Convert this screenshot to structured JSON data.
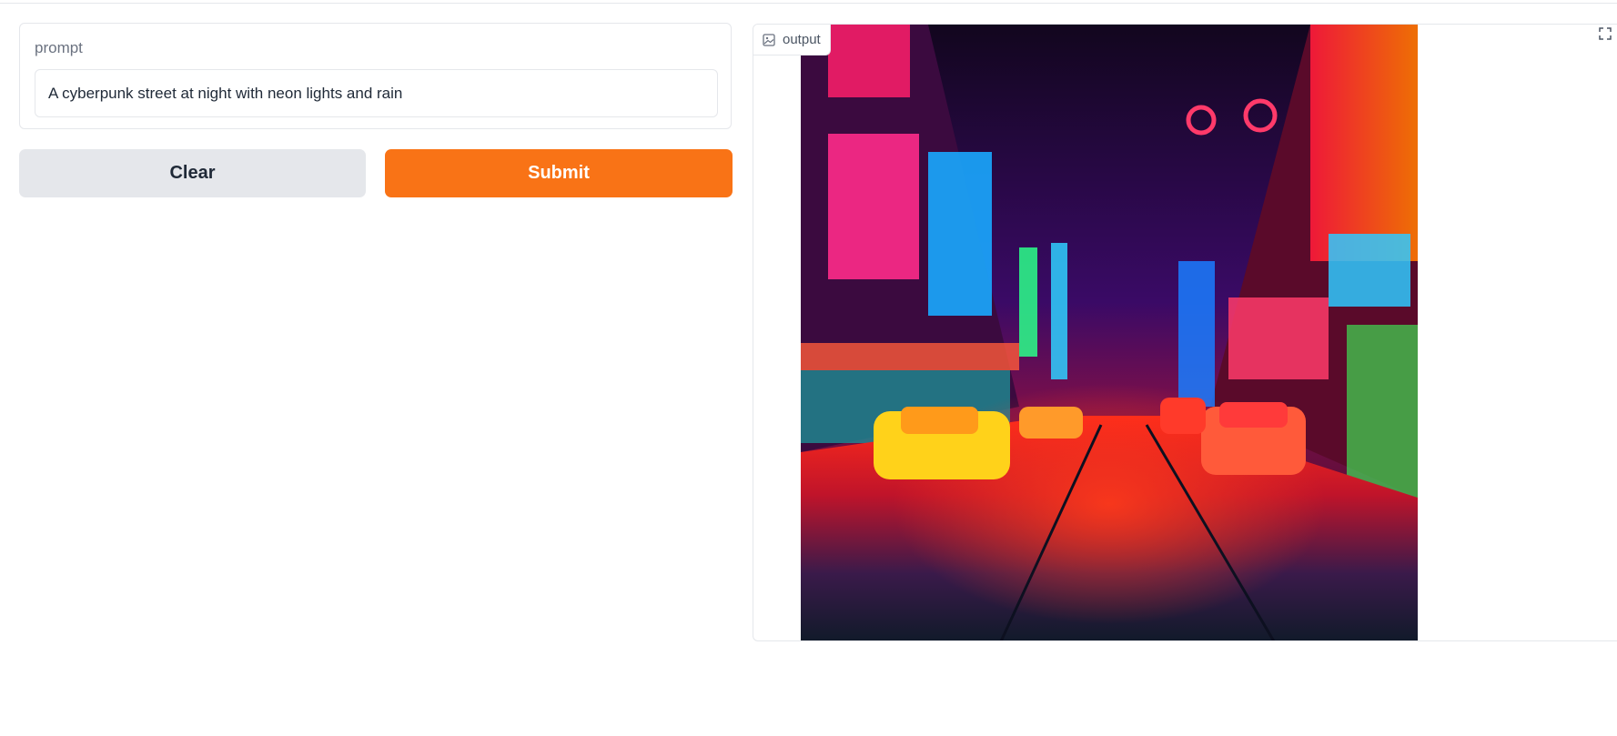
{
  "prompt": {
    "label": "prompt",
    "value": "A cyberpunk street at night with neon lights and rain"
  },
  "buttons": {
    "clear_label": "Clear",
    "submit_label": "Submit"
  },
  "output": {
    "label": "output",
    "image_alt": "A cyberpunk street at night with neon lights and rain"
  },
  "colors": {
    "accent": "#f97316",
    "secondary_button": "#e5e7eb"
  },
  "icons": {
    "output_label_icon": "image-icon",
    "fullscreen": "fullscreen-icon"
  }
}
